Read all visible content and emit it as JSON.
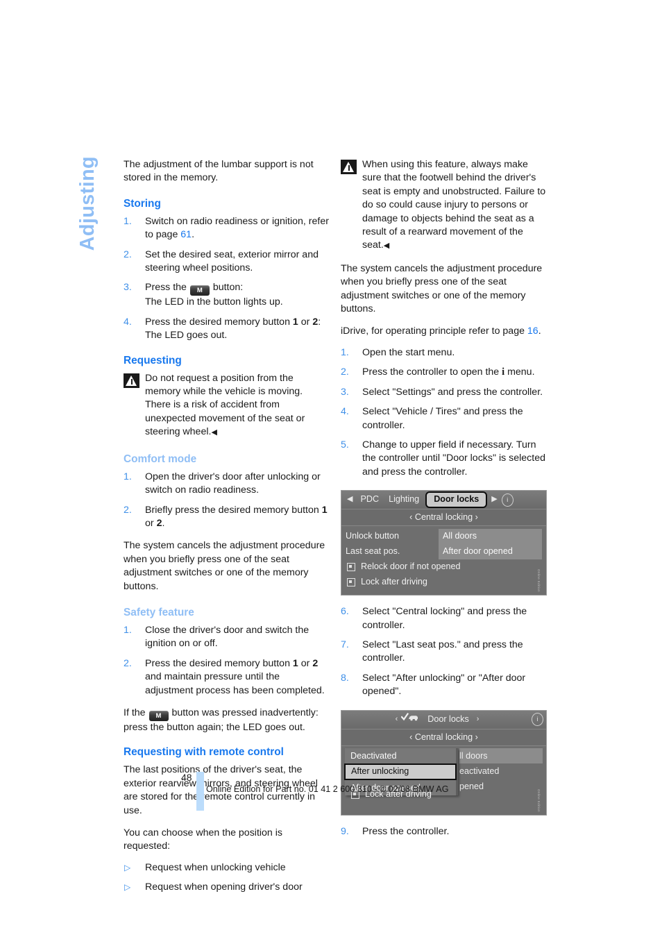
{
  "chapter_tab": "Adjusting",
  "left_column": {
    "intro": "The adjustment of the lumbar support is not stored in the memory.",
    "storing": {
      "heading": "Storing",
      "steps": [
        {
          "num": "1.",
          "text_before": "Switch on radio readiness or ignition, refer to page ",
          "page_ref": "61",
          "text_after": "."
        },
        {
          "num": "2.",
          "text_before": "Set the desired seat, exterior mirror and steering wheel positions.",
          "page_ref": "",
          "text_after": ""
        },
        {
          "num": "3.",
          "text_before": "Press the ",
          "button": "M",
          "text_after": " button:",
          "line2": "The LED in the button lights up."
        },
        {
          "num": "4.",
          "text_before": "Press the desired memory button ",
          "bold_a": "1",
          "mid": " or ",
          "bold_b": "2",
          "text_after": ":",
          "line2": "The LED goes out."
        }
      ]
    },
    "requesting": {
      "heading": "Requesting",
      "warning": "Do not request a position from the memory while the vehicle is moving. There is a risk of accident from unexpected movement of the seat or steering wheel.",
      "warning_end_mark": "◀"
    },
    "comfort_mode": {
      "heading": "Comfort mode",
      "steps": [
        {
          "num": "1.",
          "text": "Open the driver's door after unlocking or switch on radio readiness."
        },
        {
          "num": "2.",
          "text_before": "Briefly press the desired memory button ",
          "bold_a": "1",
          "mid": " or ",
          "bold_b": "2",
          "text_after": "."
        }
      ],
      "note": "The system cancels the adjustment procedure when you briefly press one of the seat adjustment switches or one of the memory buttons."
    },
    "safety_feature": {
      "heading": "Safety feature",
      "steps": [
        {
          "num": "1.",
          "text": "Close the driver's door and switch the ignition on or off."
        },
        {
          "num": "2.",
          "text_before": "Press the desired memory button ",
          "bold_a": "1",
          "mid": " or ",
          "bold_b": "2",
          "text_after": " and maintain pressure until the adjustment process has been completed."
        }
      ],
      "note_before": "If the ",
      "note_button": "M",
      "note_after": " button was pressed inadvertently: press the button again; the LED goes out."
    },
    "remote_control": {
      "heading": "Requesting with remote control",
      "para1": "The last positions of the driver's seat, the exterior rearview mirrors, and steering wheel are stored for the remote control currently in use.",
      "para2": "You can choose when the position is requested:",
      "bullets": [
        "Request when unlocking vehicle",
        "Request when opening driver's door"
      ]
    }
  },
  "right_column": {
    "warning": "When using this feature, always make sure that the footwell behind the driver's seat is empty and unobstructed. Failure to do so could cause injury to persons or damage to objects behind the seat as a result of a rearward movement of the seat.",
    "warning_end_mark": "◀",
    "note": "The system cancels the adjustment procedure when you briefly press one of the seat adjustment switches or one of the memory buttons.",
    "idrive_ref_before": "iDrive, for operating principle refer to page ",
    "idrive_ref_page": "16",
    "idrive_ref_after": ".",
    "steps": [
      {
        "num": "1.",
        "text": "Open the start menu."
      },
      {
        "num": "2.",
        "text_before": "Press the controller to open the ",
        "icon": "i",
        "text_after": " menu."
      },
      {
        "num": "3.",
        "text": "Select \"Settings\" and press the controller."
      },
      {
        "num": "4.",
        "text": "Select \"Vehicle / Tires\" and press the controller."
      },
      {
        "num": "5.",
        "text": "Change to upper field if necessary. Turn the controller until \"Door locks\" is selected and press the controller."
      }
    ],
    "steps2": [
      {
        "num": "6.",
        "text": "Select \"Central locking\" and press the controller."
      },
      {
        "num": "7.",
        "text": "Select \"Last seat pos.\" and press the controller."
      },
      {
        "num": "8.",
        "text": "Select \"After unlocking\" or \"After door opened\"."
      }
    ],
    "steps3": [
      {
        "num": "9.",
        "text": "Press the controller."
      }
    ]
  },
  "idrive_screen_1": {
    "arrow_left": "◀",
    "arrow_right": "▶",
    "tabs": [
      "PDC",
      "Lighting"
    ],
    "selected_tab": "Door locks",
    "badge": "i",
    "subtitle": "Central locking",
    "sub_arrow_left": "‹",
    "sub_arrow_right": "›",
    "rows": [
      {
        "label": "Unlock button",
        "value": "All doors"
      },
      {
        "label": "Last seat pos.",
        "value": "After door opened"
      }
    ],
    "checkboxes": [
      "Relock door if not opened",
      "Lock after driving"
    ],
    "watermark": "Online Edition"
  },
  "idrive_screen_2": {
    "title": "Door locks",
    "title_arrow_left": "‹",
    "title_arrow_right": "›",
    "badge": "i",
    "subtitle": "Central locking",
    "sub_arrow_left": "‹",
    "sub_arrow_right": "›",
    "popup_options": [
      {
        "label": "Deactivated",
        "selected": false
      },
      {
        "label": "After unlocking",
        "selected": true
      },
      {
        "label": "After door opened",
        "selected": false
      }
    ],
    "background_rows": [
      "ll doors",
      "eactivated",
      "pened"
    ],
    "checkbox": "Lock after driving",
    "watermark": "Online Edition"
  },
  "footer": {
    "page_number": "48",
    "text": "Online Edition for Part no. 01 41 2 600 310 - © 02/08 BMW AG",
    "bar_color": "#BBDCFB"
  }
}
